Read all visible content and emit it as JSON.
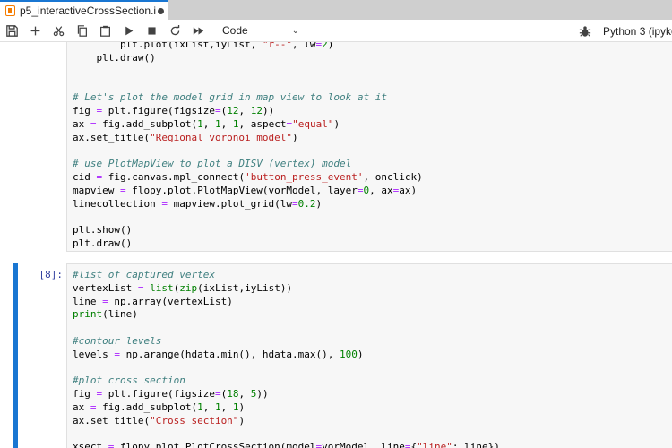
{
  "tab": {
    "title": "p5_interactiveCrossSection.ip"
  },
  "toolbar": {
    "icons": [
      "save-icon",
      "add-icon",
      "cut-icon",
      "copy-icon",
      "paste-icon",
      "run-icon",
      "stop-icon",
      "restart-icon",
      "fast-forward-icon"
    ],
    "cell_type": "Code",
    "kernel_name": "Python 3 (ipyke"
  },
  "cells": [
    {
      "prompt": "",
      "lines": [
        "        plt.plot(ixList,iyList, \"r--\", lw=2)",
        "    plt.draw()",
        "",
        "",
        "# Let's plot the model grid in map view to look at it",
        "fig = plt.figure(figsize=(12, 12))",
        "ax = fig.add_subplot(1, 1, 1, aspect=\"equal\")",
        "ax.set_title(\"Regional voronoi model\")",
        "",
        "# use PlotMapView to plot a DISV (vertex) model",
        "cid = fig.canvas.mpl_connect('button_press_event', onclick)",
        "mapview = flopy.plot.PlotMapView(vorModel, layer=0, ax=ax)",
        "linecollection = mapview.plot_grid(lw=0.2)",
        "",
        "plt.show()",
        "plt.draw()"
      ]
    },
    {
      "prompt": "[8]:",
      "lines": [
        "#list of captured vertex",
        "vertexList = list(zip(ixList,iyList))",
        "line = np.array(vertexList)",
        "print(line)",
        "",
        "#contour levels",
        "levels = np.arange(hdata.min(), hdata.max(), 100)",
        "",
        "#plot cross section",
        "fig = plt.figure(figsize=(18, 5))",
        "ax = fig.add_subplot(1, 1, 1)",
        "ax.set_title(\"Cross section\")",
        "",
        "xsect = flopy.plot.PlotCrossSection(model=vorModel, line={\"line\": line})"
      ]
    }
  ]
}
